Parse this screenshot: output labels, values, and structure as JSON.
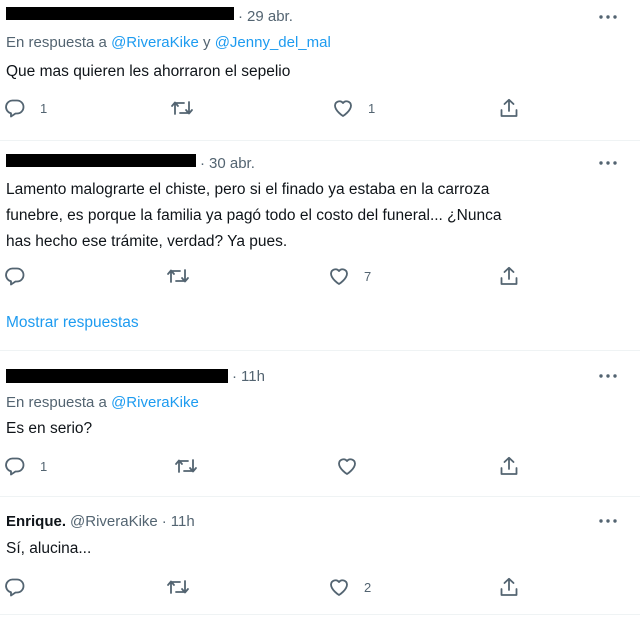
{
  "tweets": [
    {
      "time": "29 abr.",
      "reply_prefix": "En respuesta a",
      "reply_handle_1": "@RiveraKike",
      "reply_joiner": "y",
      "reply_handle_2": "@Jenny_del_mal",
      "text": "Que mas quieren les ahorraron el sepelio",
      "replies": "1",
      "retweets": "",
      "likes": "1"
    },
    {
      "time": "30 abr.",
      "text_lines": [
        "Lamento malograrte el chiste, pero si el finado ya estaba en la carroza",
        "funebre, es porque la familia ya pagó todo el costo del funeral... ¿Nunca",
        "has hecho ese trámite, verdad? Ya pues."
      ],
      "replies": "",
      "retweets": "",
      "likes": "7"
    },
    {
      "time": "11h",
      "reply_prefix": "En respuesta a",
      "reply_handle_1": "@RiveraKike",
      "text": "Es en serio?",
      "replies": "1",
      "retweets": "",
      "likes": ""
    },
    {
      "name": "Enrique.",
      "handle": "@RiveraKike",
      "time": "11h",
      "text": "Sí, alucina...",
      "replies": "",
      "retweets": "",
      "likes": "2"
    }
  ],
  "show_replies": "Mostrar respuestas",
  "time_sep": "·",
  "icons": [
    "reply-icon",
    "retweet-icon",
    "like-icon",
    "share-icon",
    "more-icon"
  ],
  "colors": {
    "link": "#1d9bf0",
    "muted": "#536471",
    "text": "#0f1419"
  }
}
